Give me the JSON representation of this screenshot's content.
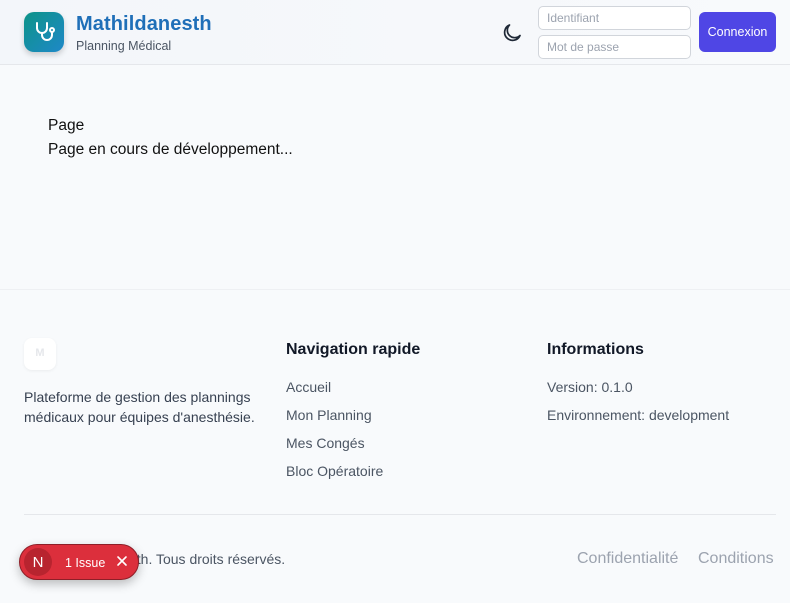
{
  "header": {
    "brand_title": "Mathildanesth",
    "brand_subtitle": "Planning Médical",
    "login": {
      "username_placeholder": "Identifiant",
      "password_placeholder": "Mot de passe",
      "submit_label": "Connexion"
    },
    "icons": {
      "logo": "stethoscope-icon",
      "theme": "moon-icon"
    }
  },
  "main": {
    "heading": "Page",
    "body": "Page en cours de développement..."
  },
  "footer": {
    "description": "Plateforme de gestion des plannings médicaux pour équipes d'anesthésie.",
    "nav_title": "Navigation rapide",
    "nav_links": [
      "Accueil",
      "Mon Planning",
      "Mes Congés",
      "Bloc Opératoire"
    ],
    "info_title": "Informations",
    "info_lines": [
      "Version: 0.1.0",
      "Environnement: development"
    ],
    "copyright": "esth. Tous droits réservés.",
    "legal_links": [
      "Confidentialité",
      "Conditions"
    ]
  },
  "issue_badge": {
    "logo_letter": "N",
    "label": "1 Issue"
  },
  "colors": {
    "brand_title": "#1f6fb8",
    "logo_gradient_start": "#0d9488",
    "logo_gradient_end": "#1e88c8",
    "primary_button": "#4f46e5",
    "issue_badge": "#dc2f3c"
  }
}
